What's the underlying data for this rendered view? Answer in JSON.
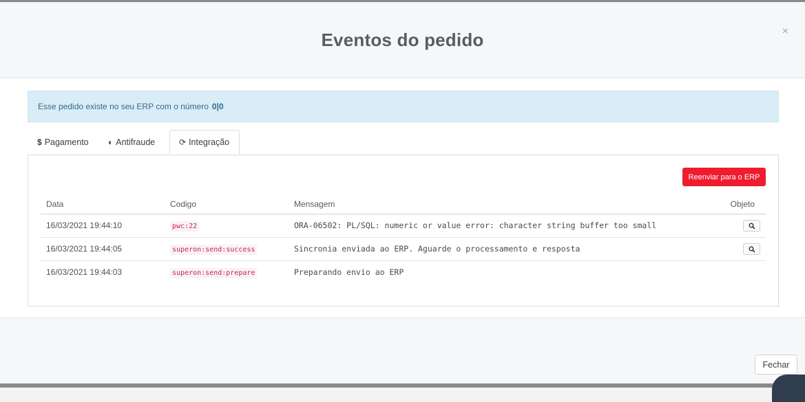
{
  "modal": {
    "title": "Eventos do pedido",
    "close_symbol": "×"
  },
  "alert": {
    "text": "Esse pedido existe no seu ERP com o número",
    "number": "0|0"
  },
  "tabs": [
    {
      "icon": "$",
      "label": "Pagamento"
    },
    {
      "icon": "◐",
      "label": "Antifraude"
    },
    {
      "icon": "⟳",
      "label": "Integração"
    }
  ],
  "resend_button": "Reenviar para o ERP",
  "table": {
    "headers": {
      "date": "Data",
      "code": "Codigo",
      "message": "Mensagem",
      "object": "Objeto"
    },
    "rows": [
      {
        "date": "16/03/2021 19:44:10",
        "code": "pwc:22",
        "message": "ORA-06502: PL/SQL: numeric or value error: character string buffer too small",
        "has_object": true
      },
      {
        "date": "16/03/2021 19:44:05",
        "code": "superon:send:success",
        "message": "Sincronia enviada ao ERP. Aguarde o processamento e resposta",
        "has_object": true
      },
      {
        "date": "16/03/2021 19:44:03",
        "code": "superon:send:prepare",
        "message": "Preparando envio ao ERP",
        "has_object": false
      }
    ]
  },
  "footer": {
    "close_button": "Fechar"
  },
  "colors": {
    "accent_red": "#ee1c2e",
    "alert_bg": "#d9edf7",
    "code_color": "#c7254e"
  }
}
